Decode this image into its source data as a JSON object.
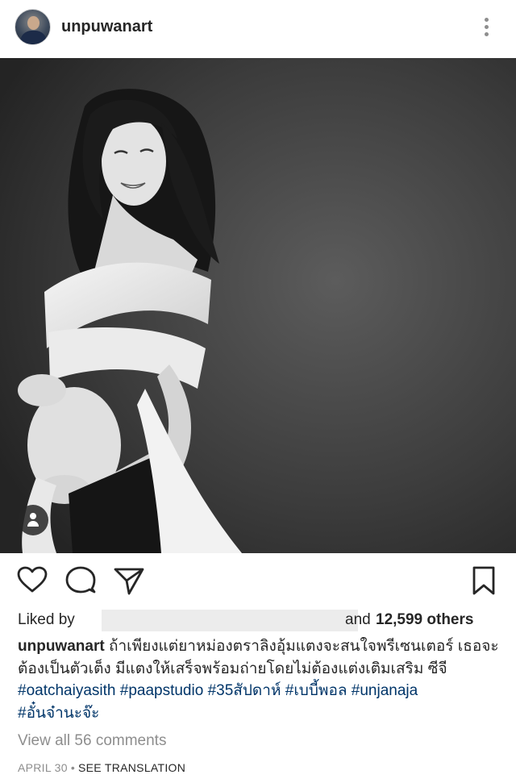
{
  "header": {
    "username": "unpuwanart",
    "avatar_icon": "profile-avatar",
    "more_icon": "more-vertical-icon"
  },
  "post": {
    "photo_description_icon": "black-and-white-portrait-photo",
    "user_tag_icon": "user-tag-icon"
  },
  "actions": {
    "like_icon": "heart-icon",
    "comment_icon": "comment-icon",
    "share_icon": "paper-plane-icon",
    "save_icon": "bookmark-icon"
  },
  "likes": {
    "prefix": "Liked by",
    "conjunction": "and",
    "count_text": "12,599 others"
  },
  "caption": {
    "username": "unpuwanart",
    "text": "ถ้าเพียงแต่ยาหม่องตราลิงอุ้มแตงจะสนใจพรีเซนเตอร์ เธอจะต้องเป็นตัวเต็ง มีแตงให้เสร็จพร้อมถ่ายโดยไม่ต้องแต่งเติมเสริม ซีจี ",
    "hashtags": [
      "#oatchaiyasith",
      "#paapstudio",
      "#35สัปดาห์",
      "#เบบี้พอล",
      "#unjanaja",
      "#อั๋นจ๋านะจ๊ะ"
    ]
  },
  "comments": {
    "view_all": "View all 56 comments"
  },
  "meta": {
    "date": "APRIL 30",
    "separator": "•",
    "translate": "SEE TRANSLATION"
  },
  "colors": {
    "text": "#262626",
    "secondary": "#8e8e8e",
    "hashtag": "#003569",
    "photo_bg": "#3a3a3a"
  }
}
